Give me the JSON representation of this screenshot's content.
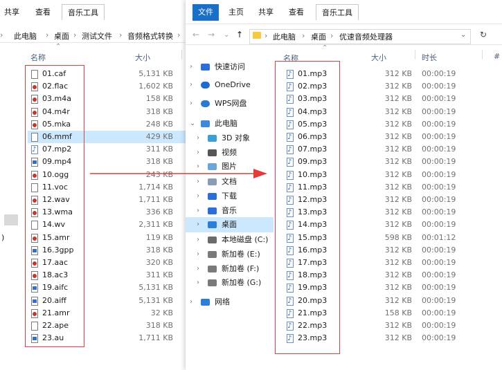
{
  "left_window": {
    "ribbon_tabs": [
      "共享",
      "查看",
      "音乐工具"
    ],
    "breadcrumb": [
      "此电脑",
      "桌面",
      "测试文件",
      "音频格式转换"
    ],
    "columns": {
      "name": "名称",
      "size": "大小"
    },
    "files": [
      {
        "name": "01.caf",
        "size": "5,131 KB",
        "icon": "blank-file-icon"
      },
      {
        "name": "02.flac",
        "size": "1,602 KB",
        "icon": "audio-red-icon"
      },
      {
        "name": "03.m4a",
        "size": "158 KB",
        "icon": "audio-red-icon"
      },
      {
        "name": "04.m4r",
        "size": "318 KB",
        "icon": "audio-red-icon"
      },
      {
        "name": "05.mka",
        "size": "248 KB",
        "icon": "audio-red-icon"
      },
      {
        "name": "06.mmf",
        "size": "429 KB",
        "icon": "blank-file-icon",
        "selected": true
      },
      {
        "name": "07.mp2",
        "size": "311 KB",
        "icon": "music-note-icon"
      },
      {
        "name": "09.mp4",
        "size": "318 KB",
        "icon": "video-blue-icon"
      },
      {
        "name": "10.ogg",
        "size": "243 KB",
        "icon": "audio-red-icon"
      },
      {
        "name": "11.voc",
        "size": "1,714 KB",
        "icon": "blank-file-icon"
      },
      {
        "name": "12.wav",
        "size": "1,711 KB",
        "icon": "audio-red-icon"
      },
      {
        "name": "13.wma",
        "size": "336 KB",
        "icon": "audio-red-icon"
      },
      {
        "name": "14.wv",
        "size": "2,311 KB",
        "icon": "blank-file-icon"
      },
      {
        "name": "15.amr",
        "size": "119 KB",
        "icon": "audio-red-icon"
      },
      {
        "name": "16.3gpp",
        "size": "318 KB",
        "icon": "video-blue-icon"
      },
      {
        "name": "17.aac",
        "size": "320 KB",
        "icon": "audio-red-icon"
      },
      {
        "name": "18.ac3",
        "size": "311 KB",
        "icon": "audio-red-icon"
      },
      {
        "name": "19.aifc",
        "size": "5,131 KB",
        "icon": "video-blue-icon"
      },
      {
        "name": "20.aiff",
        "size": "5,131 KB",
        "icon": "video-blue-icon"
      },
      {
        "name": "21.amr",
        "size": "32 KB",
        "icon": "audio-red-icon"
      },
      {
        "name": "22.ape",
        "size": "318 KB",
        "icon": "blank-file-icon"
      },
      {
        "name": "23.au",
        "size": "1,711 KB",
        "icon": "video-blue-icon"
      }
    ]
  },
  "right_window": {
    "ribbon_tabs": [
      "文件",
      "主页",
      "共享",
      "查看",
      "音乐工具"
    ],
    "breadcrumb": [
      "此电脑",
      "桌面",
      "优速音频处理器"
    ],
    "columns": {
      "name": "名称",
      "size": "大小",
      "duration": "时长",
      "extra": "#"
    },
    "nav": [
      {
        "label": "快速访问",
        "icon": "star-icon",
        "chev": "›"
      },
      {
        "label": "OneDrive",
        "icon": "cloud-icon",
        "chev": "›"
      },
      {
        "label": "WPS网盘",
        "icon": "wps-cloud-icon",
        "chev": "›"
      },
      {
        "label": "此电脑",
        "icon": "computer-icon",
        "chev": "⌄"
      },
      {
        "label": "3D 对象",
        "icon": "cube-icon",
        "chev": "›"
      },
      {
        "label": "视频",
        "icon": "video-folder-icon",
        "chev": "›"
      },
      {
        "label": "图片",
        "icon": "picture-folder-icon",
        "chev": "›"
      },
      {
        "label": "文档",
        "icon": "document-folder-icon",
        "chev": "›"
      },
      {
        "label": "下载",
        "icon": "download-icon",
        "chev": "›"
      },
      {
        "label": "音乐",
        "icon": "music-icon",
        "chev": "›"
      },
      {
        "label": "桌面",
        "icon": "desktop-icon",
        "chev": "›",
        "selected": true
      },
      {
        "label": "本地磁盘 (C:)",
        "icon": "drive-c-icon",
        "chev": "›"
      },
      {
        "label": "新加卷 (E:)",
        "icon": "drive-icon",
        "chev": "›"
      },
      {
        "label": "新加卷 (F:)",
        "icon": "drive-icon",
        "chev": "›"
      },
      {
        "label": "新加卷 (G:)",
        "icon": "drive-icon",
        "chev": "›"
      },
      {
        "label": "网络",
        "icon": "network-icon",
        "chev": "›"
      }
    ],
    "files": [
      {
        "name": "01.mp3",
        "size": "312 KB",
        "duration": "00:00:19"
      },
      {
        "name": "02.mp3",
        "size": "312 KB",
        "duration": "00:00:19"
      },
      {
        "name": "03.mp3",
        "size": "312 KB",
        "duration": "00:00:19"
      },
      {
        "name": "04.mp3",
        "size": "312 KB",
        "duration": "00:00:19"
      },
      {
        "name": "05.mp3",
        "size": "312 KB",
        "duration": "00:00:19"
      },
      {
        "name": "06.mp3",
        "size": "312 KB",
        "duration": "00:00:19"
      },
      {
        "name": "07.mp3",
        "size": "312 KB",
        "duration": "00:00:19"
      },
      {
        "name": "09.mp3",
        "size": "312 KB",
        "duration": "00:00:19"
      },
      {
        "name": "10.mp3",
        "size": "312 KB",
        "duration": "00:00:19"
      },
      {
        "name": "11.mp3",
        "size": "312 KB",
        "duration": "00:00:19"
      },
      {
        "name": "12.mp3",
        "size": "312 KB",
        "duration": "00:00:19"
      },
      {
        "name": "13.mp3",
        "size": "312 KB",
        "duration": "00:00:19"
      },
      {
        "name": "14.mp3",
        "size": "312 KB",
        "duration": "00:00:19"
      },
      {
        "name": "15.mp3",
        "size": "598 KB",
        "duration": "00:01:12"
      },
      {
        "name": "16.mp3",
        "size": "312 KB",
        "duration": "00:00:19"
      },
      {
        "name": "17.mp3",
        "size": "312 KB",
        "duration": "00:00:19"
      },
      {
        "name": "18.mp3",
        "size": "312 KB",
        "duration": "00:00:19"
      },
      {
        "name": "19.mp3",
        "size": "312 KB",
        "duration": "00:00:19"
      },
      {
        "name": "20.mp3",
        "size": "312 KB",
        "duration": "00:00:19"
      },
      {
        "name": "21.mp3",
        "size": "158 KB",
        "duration": "00:00:19"
      },
      {
        "name": "22.mp3",
        "size": "312 KB",
        "duration": "00:00:19"
      },
      {
        "name": "23.mp3",
        "size": "312 KB",
        "duration": "00:00:19"
      }
    ]
  },
  "colors": {
    "accent": "#1a6fc7",
    "highlight_box": "#e23b3b",
    "selection": "#cce8ff",
    "arrow": "#e23b3b"
  }
}
